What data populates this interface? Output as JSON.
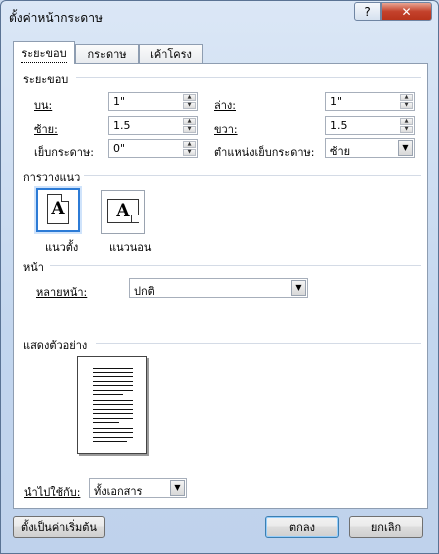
{
  "window": {
    "title": "ตั้งค่าหน้ากระดาษ",
    "help_label": "?",
    "close_label": "✕"
  },
  "tabs": [
    {
      "label": "ระยะขอบ",
      "active": true
    },
    {
      "label": "กระดาษ",
      "active": false
    },
    {
      "label": "เค้าโครง",
      "active": false
    }
  ],
  "margins": {
    "heading": "ระยะขอบ",
    "top_label": "บน:",
    "top_value": "1\"",
    "bottom_label": "ล่าง:",
    "bottom_value": "1\"",
    "left_label": "ซ้าย:",
    "left_value": "1.5",
    "right_label": "ขวา:",
    "right_value": "1.5",
    "gutter_label": "เย็บกระดาษ:",
    "gutter_value": "0\"",
    "gutter_pos_label": "ตำแหน่งเย็บกระดาษ:",
    "gutter_pos_value": "ซ้าย"
  },
  "orientation": {
    "heading": "การวางแนว",
    "glyph": "A",
    "portrait_label": "แนวตั้ง",
    "landscape_label": "แนวนอน",
    "selected": "portrait"
  },
  "pages": {
    "heading": "หน้า",
    "multiple_label": "หลายหน้า:",
    "multiple_value": "ปกติ"
  },
  "preview": {
    "heading": "แสดงตัวอย่าง"
  },
  "apply": {
    "label": "นำไปใช้กับ:",
    "value": "ทั้งเอกสาร"
  },
  "footer": {
    "default_button": "ตั้งเป็นค่าเริ่มต้น",
    "ok_button": "ตกลง",
    "cancel_button": "ยกเลิก"
  }
}
